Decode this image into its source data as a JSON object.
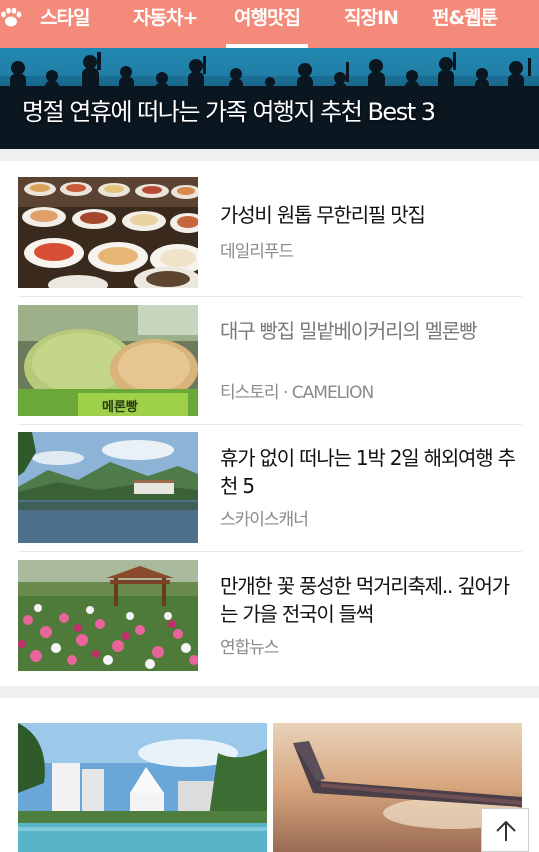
{
  "nav": {
    "tabs": [
      {
        "label": "스타일",
        "active": false
      },
      {
        "label": "자동차+",
        "active": false
      },
      {
        "label": "여행맛집",
        "active": true
      },
      {
        "label": "직장IN",
        "active": false
      },
      {
        "label": "펀&웹툰",
        "active": false
      }
    ],
    "icon": "paw-icon"
  },
  "hero": {
    "title": "명절 연휴에 떠나는 가족 여행지 추천 Best 3"
  },
  "articles": [
    {
      "title": "가성비 원톱 무한리필 맛집",
      "source": "데일리푸드",
      "visited": false,
      "image": "buffet-dishes"
    },
    {
      "title": "대구 빵집 밀밭베이커리의 멜론빵",
      "source": "티스토리 · CAMELION",
      "visited": true,
      "image": "melon-bread"
    },
    {
      "title": "휴가 없이 떠나는 1박 2일 해외여행 추천 5",
      "source": "스카이스캐너",
      "visited": false,
      "image": "lake-mountains"
    },
    {
      "title": "만개한 꽃 풍성한 먹거리축제.. 깊어가는 가을 전국이 들썩",
      "source": "연합뉴스",
      "visited": false,
      "image": "cosmos-field"
    }
  ],
  "cards": [
    {
      "image": "resort-pool"
    },
    {
      "image": "airplane-wing"
    }
  ],
  "scroll_top": {
    "icon": "arrow-up-icon"
  },
  "colors": {
    "nav_bg": "#f48a7a",
    "nav_text": "#ffffff",
    "separator": "#efefef",
    "source_text": "#8a8a8a"
  }
}
